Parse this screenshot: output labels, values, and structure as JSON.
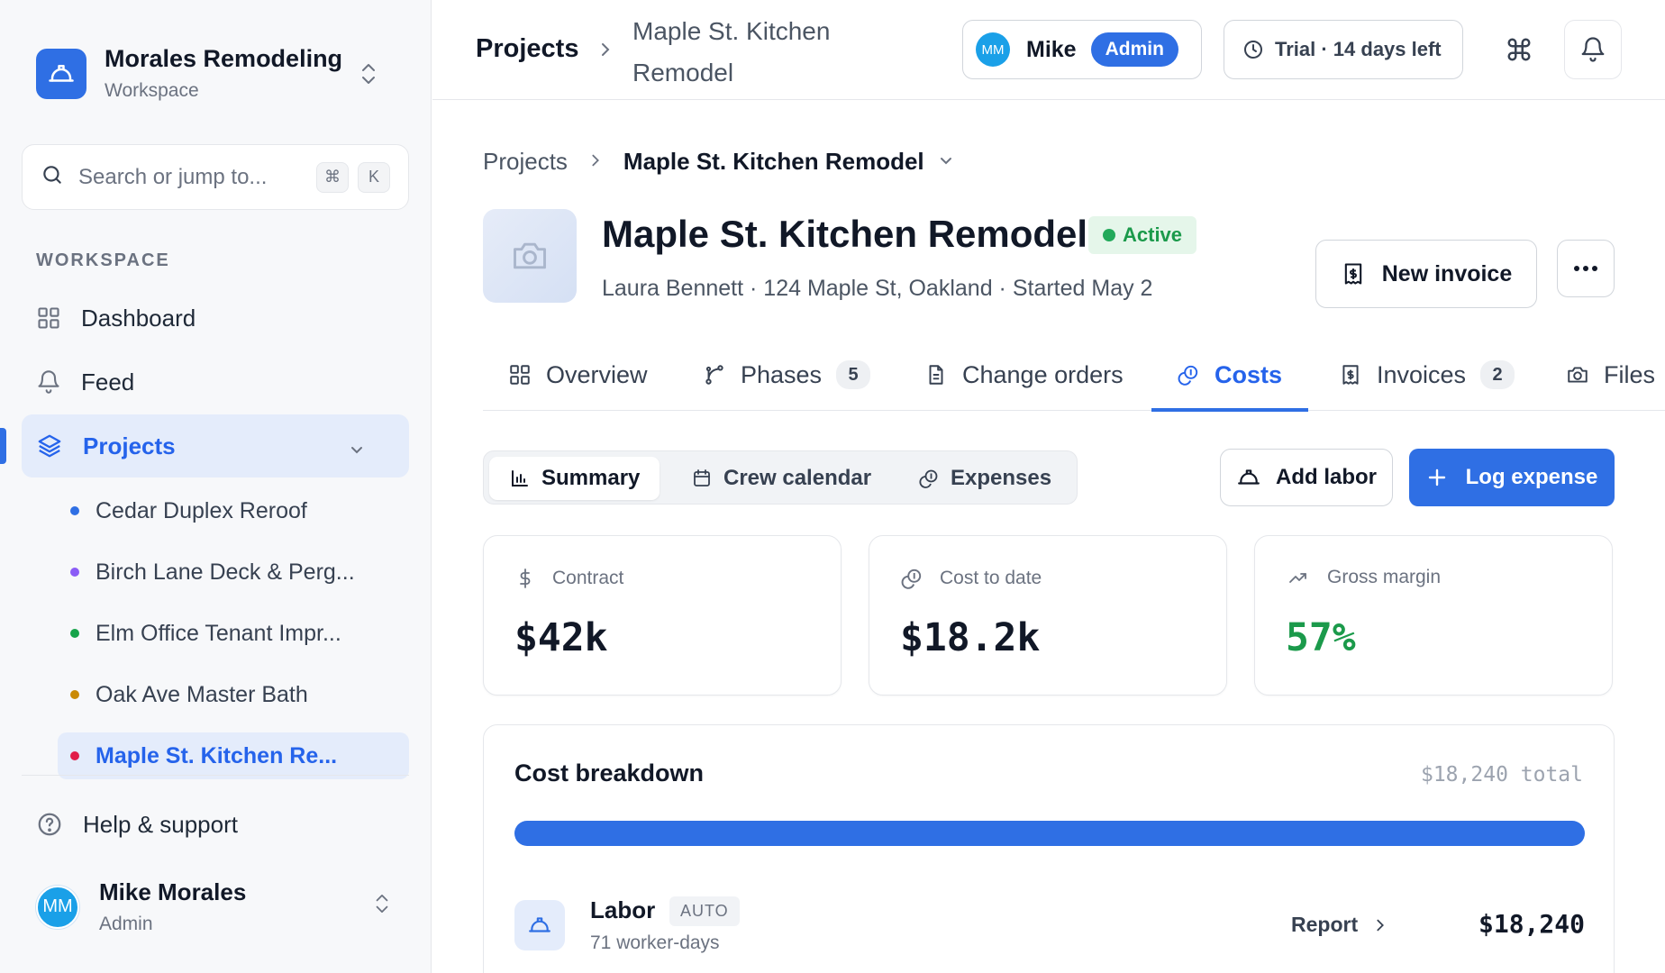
{
  "workspace": {
    "name": "Morales Remodeling",
    "subtitle": "Workspace"
  },
  "search": {
    "placeholder": "Search or jump to...",
    "shortcut": [
      "⌘",
      "K"
    ]
  },
  "sidebar": {
    "section_label": "WORKSPACE",
    "items": [
      {
        "label": "Dashboard",
        "icon": "grid-icon"
      },
      {
        "label": "Feed",
        "icon": "bell-icon"
      },
      {
        "label": "Projects",
        "icon": "layers-icon",
        "active": true
      }
    ],
    "projects": [
      {
        "label": "Cedar Duplex Reroof",
        "color": "#2f6fe4"
      },
      {
        "label": "Birch Lane Deck & Perg...",
        "color": "#8b5cf6"
      },
      {
        "label": "Elm Office Tenant Impr...",
        "color": "#16a34a"
      },
      {
        "label": "Oak Ave Master Bath",
        "color": "#ca8a04"
      },
      {
        "label": "Maple St. Kitchen Re...",
        "color": "#e11d48",
        "active": true
      }
    ],
    "help": "Help & support",
    "user": {
      "initials": "MM",
      "name": "Mike Morales",
      "role": "Admin"
    }
  },
  "topbar": {
    "crumb_root": "Projects",
    "crumb_current": "Maple St. Kitchen Remodel",
    "user": {
      "initials": "MM",
      "name": "Mike",
      "badge": "Admin"
    },
    "trial": "Trial · 14 days left"
  },
  "project": {
    "breadcrumb_root": "Projects",
    "breadcrumb_current": "Maple St. Kitchen Remodel",
    "title": "Maple St. Kitchen Remodel",
    "status": "Active",
    "meta": "Laura Bennett · 124 Maple St, Oakland · Started May 2",
    "new_invoice": "New invoice"
  },
  "tabs": [
    {
      "label": "Overview",
      "icon": "grid-icon"
    },
    {
      "label": "Phases",
      "count": "5",
      "icon": "branch-icon"
    },
    {
      "label": "Change orders",
      "icon": "document-icon"
    },
    {
      "label": "Costs",
      "icon": "coins-icon",
      "active": true
    },
    {
      "label": "Invoices",
      "count": "2",
      "icon": "receipt-icon"
    },
    {
      "label": "Files",
      "icon": "camera-icon"
    }
  ],
  "costs": {
    "segments": [
      {
        "label": "Summary",
        "active": true
      },
      {
        "label": "Crew calendar"
      },
      {
        "label": "Expenses"
      }
    ],
    "add_labor": "Add labor",
    "log_expense": "Log expense",
    "stats": [
      {
        "label": "Contract",
        "value": "$42k",
        "icon": "dollar-icon"
      },
      {
        "label": "Cost to date",
        "value": "$18.2k",
        "icon": "coins-icon"
      },
      {
        "label": "Gross margin",
        "value": "57%",
        "icon": "trend-up-icon",
        "color": "#1b9a4b"
      }
    ],
    "breakdown": {
      "title": "Cost breakdown",
      "total": "$18,240 total",
      "labor_share": 1.0,
      "rows": [
        {
          "name": "Labor",
          "tag": "AUTO",
          "sub": "71 worker-days",
          "report": "Report",
          "amount": "$18,240"
        }
      ]
    }
  }
}
